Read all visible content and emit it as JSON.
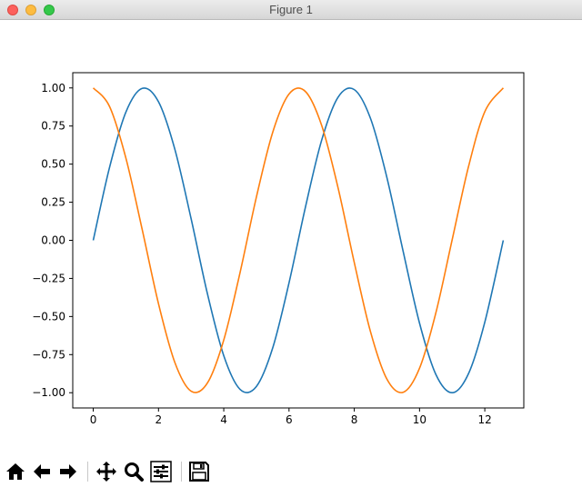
{
  "window": {
    "title": "Figure 1"
  },
  "toolbar": {
    "buttons": [
      {
        "name": "home-button",
        "icon": "home-icon"
      },
      {
        "name": "back-button",
        "icon": "arrow-left-icon"
      },
      {
        "name": "forward-button",
        "icon": "arrow-right-icon"
      },
      {
        "name": "pan-button",
        "icon": "move-icon"
      },
      {
        "name": "zoom-button",
        "icon": "magnifier-icon"
      },
      {
        "name": "subplots-button",
        "icon": "sliders-icon"
      },
      {
        "name": "save-button",
        "icon": "floppy-disk-icon"
      }
    ]
  },
  "chart_data": {
    "type": "line",
    "title": "",
    "xlabel": "",
    "ylabel": "",
    "xlim": [
      -0.628,
      13.195
    ],
    "ylim": [
      -1.1,
      1.1
    ],
    "xticks": [
      0,
      2,
      4,
      6,
      8,
      10,
      12
    ],
    "xtick_labels": [
      "0",
      "2",
      "4",
      "6",
      "8",
      "10",
      "12"
    ],
    "yticks": [
      1.0,
      0.75,
      0.5,
      0.25,
      0.0,
      -0.25,
      -0.5,
      -0.75,
      -1.0
    ],
    "ytick_labels": [
      "1.00",
      "0.75",
      "0.50",
      "0.25",
      "0.00",
      "−0.25",
      "−0.50",
      "−0.75",
      "−1.00"
    ],
    "grid": false,
    "legend": "none",
    "x": [
      0,
      0.5,
      1.0,
      1.5,
      2.0,
      2.5,
      3.0,
      3.5,
      4.0,
      4.5,
      5.0,
      5.5,
      6.0,
      6.5,
      7.0,
      7.5,
      8.0,
      8.5,
      9.0,
      9.5,
      10.0,
      10.5,
      11.0,
      11.5,
      12.0,
      12.566
    ],
    "series": [
      {
        "color": "#1f77b4",
        "values": [
          0.0,
          0.479,
          0.841,
          0.997,
          0.909,
          0.598,
          0.141,
          -0.351,
          -0.757,
          -0.978,
          -0.959,
          -0.706,
          -0.279,
          0.215,
          0.657,
          0.938,
          0.989,
          0.798,
          0.412,
          -0.075,
          -0.544,
          -0.88,
          -1.0,
          -0.875,
          -0.537,
          0.0
        ]
      },
      {
        "color": "#ff7f0e",
        "values": [
          1.0,
          0.878,
          0.54,
          0.071,
          -0.416,
          -0.801,
          -0.99,
          -0.936,
          -0.654,
          -0.211,
          0.284,
          0.709,
          0.96,
          0.977,
          0.754,
          0.347,
          -0.146,
          -0.602,
          -0.911,
          -0.997,
          -0.839,
          -0.476,
          0.004,
          0.483,
          0.844,
          1.0
        ]
      }
    ]
  }
}
